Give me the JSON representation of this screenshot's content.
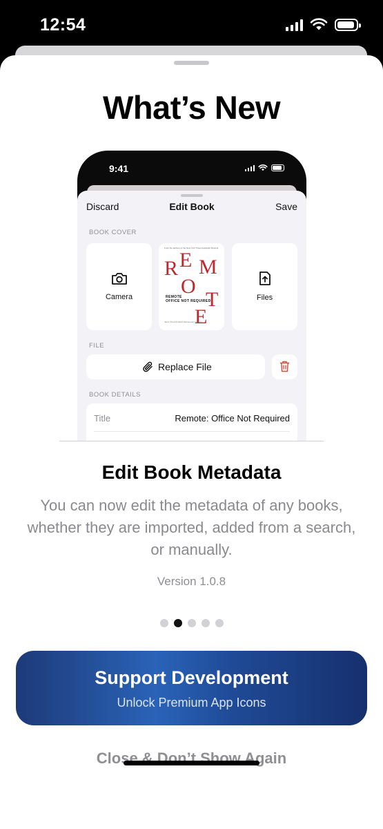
{
  "status_bar": {
    "time": "12:54",
    "icons": [
      "cellular-signal-icon",
      "wifi-icon",
      "battery-icon"
    ]
  },
  "sheet": {
    "title": "What’s New",
    "preview": {
      "status_time": "9:41",
      "nav": {
        "discard": "Discard",
        "title": "Edit Book",
        "save": "Save"
      },
      "book_cover_section": "BOOK COVER",
      "camera_label": "Camera",
      "files_label": "Files",
      "cover": {
        "top_line": "From the authors of the New York Times bestseller Rework",
        "letters": [
          "R",
          "E",
          "M",
          "O",
          "T",
          "E"
        ],
        "subtitle_1": "REMOTE",
        "subtitle_2": "OFFICE NOT REQUIRED",
        "authors": "Jason Fried & David Heinemeier Hansson"
      },
      "file_section": "FILE",
      "replace_file": "Replace File",
      "book_details_section": "BOOK DETAILS",
      "title_label": "Title",
      "title_value": "Remote: Office Not Required"
    },
    "feature_title": "Edit Book Metadata",
    "feature_description": "You can now edit the metadata of any books, whether they are imported, added from a search, or manually.",
    "version": "Version 1.0.8",
    "pager": {
      "count": 5,
      "active_index": 1
    },
    "support_button": {
      "title": "Support Development",
      "subtitle": "Unlock Premium App Icons"
    },
    "close_link": "Close & Don’t Show Again"
  },
  "colors": {
    "accent_gradient": [
      "#1d3a78",
      "#2a63b8",
      "#16306d"
    ],
    "cover_red": "#c0262d",
    "trash_red": "#e0443a",
    "secondary_text": "#8e8e93"
  }
}
